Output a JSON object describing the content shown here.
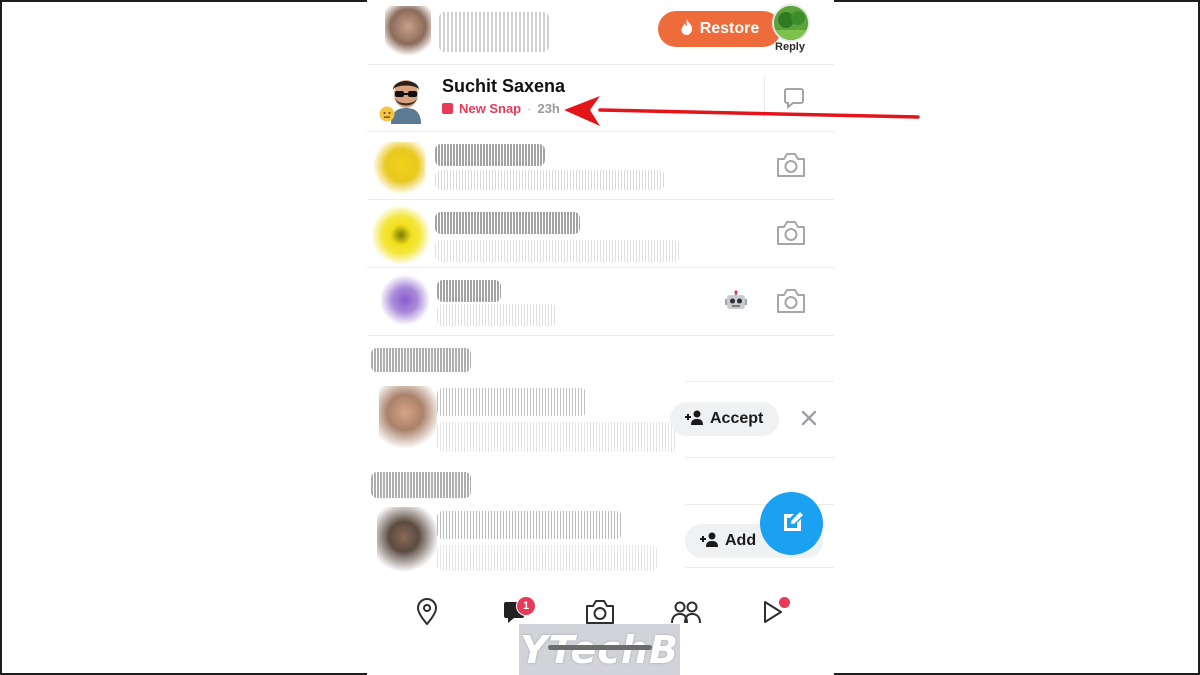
{
  "top_row": {
    "restore_label": "Restore",
    "reply_label": "Reply"
  },
  "highlighted_chat": {
    "name": "Suchit Saxena",
    "status": "New Snap",
    "separator": "·",
    "time": "23h"
  },
  "friend_requests": {
    "accept_label": "Accept",
    "add_label": "Add"
  },
  "bottom_nav": {
    "items": [
      "map-icon",
      "chat-icon",
      "camera-icon",
      "friends-icon",
      "stories-icon"
    ],
    "chat_badge": "1"
  },
  "watermark": "YTechB",
  "colors": {
    "restore_orange": "#ee6b3b",
    "new_snap_red": "#e63a58",
    "fab_blue": "#1aa1f1",
    "annotation_arrow": "#e3151b"
  }
}
